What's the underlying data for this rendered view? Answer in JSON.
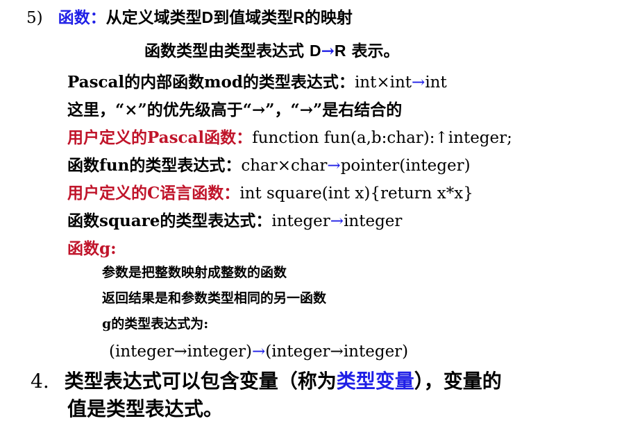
{
  "section5": {
    "number": "5)",
    "term": "函数：",
    "desc_a": "从定义域类型",
    "desc_D": "D",
    "desc_b": "到值域类型",
    "desc_R": "R",
    "desc_c": "的映射"
  },
  "line2": {
    "text_a": "函数类型由类型表达式 ",
    "D": "D",
    "arrow": "→",
    "R": "R",
    "text_b": " 表示。"
  },
  "pascal_mod": {
    "label": "Pascal的内部函数mod的类型表达式：",
    "expr_a": "int×int",
    "arrow": "→",
    "expr_b": "int"
  },
  "precedence": {
    "text": "这里，“×”的优先级高于“→”，“→”是右结合的"
  },
  "pascal_user": {
    "label": "用户定义的Pascal函数：",
    "code": "function fun(a,b:char):↑integer;"
  },
  "fun_type": {
    "label": "函数fun的类型表达式：",
    "expr_a": "char×char",
    "arrow": "→",
    "expr_b": "pointer(integer)"
  },
  "c_user": {
    "label": "用户定义的C语言函数：",
    "code": "int square(int x){return x*x}"
  },
  "square_type": {
    "label": "函数square的类型表达式：",
    "expr_a": "integer",
    "arrow": "→",
    "expr_b": "integer"
  },
  "func_g": {
    "label": "函数g:",
    "item1": "参数是把整数映射成整数的函数",
    "item2": "返回结果是和参数类型相同的另一函数",
    "item3": "g的类型表达式为:",
    "expr_a": "(integer",
    "arrow1": "→",
    "expr_b": "integer)",
    "arrow2": "→",
    "expr_c": "(integer",
    "arrow3": "→",
    "expr_d": "integer)"
  },
  "section4": {
    "number": "4.",
    "text_a": "类型表达式可以包含变量（称为",
    "term": "类型变量",
    "text_b": "），变量的",
    "text_c": "值是类型表达式。"
  },
  "colors": {
    "accent_blue": "#1f1fe6",
    "accent_red": "#c0142a",
    "text": "#000000",
    "background": "#ffffff"
  }
}
